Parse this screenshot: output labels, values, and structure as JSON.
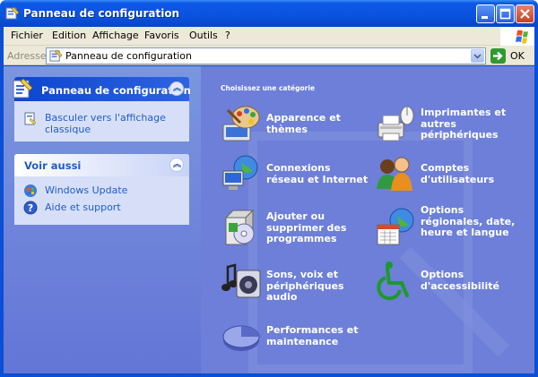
{
  "window": {
    "title": "Panneau de configuration"
  },
  "menu": {
    "items": [
      "Fichier",
      "Edition",
      "Affichage",
      "Favoris",
      "Outils",
      "?"
    ]
  },
  "address": {
    "label": "Adresse",
    "value": "Panneau de configuration",
    "go_label": "OK"
  },
  "sidebar": {
    "panel1": {
      "title": "Panneau de configuration",
      "task": "Basculer vers l'affichage classique"
    },
    "panel2": {
      "title": "Voir aussi",
      "items": [
        {
          "label": "Windows Update",
          "icon": "windows-update-icon"
        },
        {
          "label": "Aide et support",
          "icon": "help-icon"
        }
      ]
    }
  },
  "main": {
    "heading": "Choisissez une catégorie",
    "categories": [
      {
        "label": "Apparence et thèmes",
        "icon": "appearance-themes-icon"
      },
      {
        "label": "Imprimantes et autres périphériques",
        "icon": "printers-icon"
      },
      {
        "label": "Connexions réseau et Internet",
        "icon": "network-icon"
      },
      {
        "label": "Comptes d'utilisateurs",
        "icon": "user-accounts-icon"
      },
      {
        "label": "Ajouter ou supprimer des programmes",
        "icon": "add-remove-programs-icon"
      },
      {
        "label": "Options régionales, date, heure et langue",
        "icon": "regional-options-icon"
      },
      {
        "label": "Sons, voix et périphériques audio",
        "icon": "sounds-icon"
      },
      {
        "label": "Options d'accessibilité",
        "icon": "accessibility-icon"
      },
      {
        "label": "Performances et maintenance",
        "icon": "performance-icon"
      }
    ]
  },
  "colors": {
    "titlebar": "#0b53de",
    "sidebar_bg": "#6f86dc",
    "main_bg": "#6d7fd8",
    "link": "#215dc6"
  }
}
